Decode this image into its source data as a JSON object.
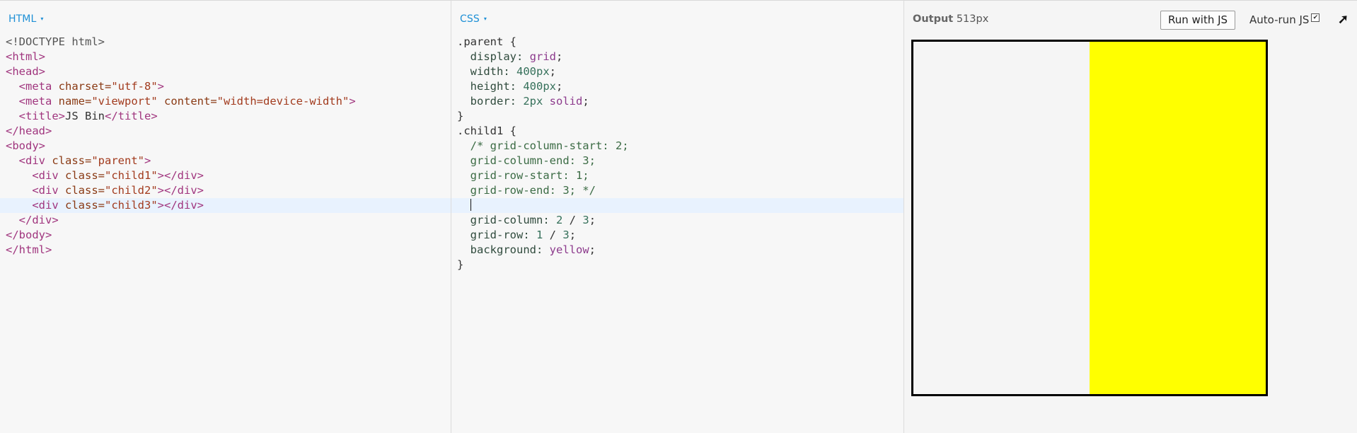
{
  "html_panel": {
    "label": "HTML",
    "caret": "▾",
    "lines": [
      [
        {
          "t": "<!DOCTYPE html>",
          "c": "doctype"
        }
      ],
      [
        {
          "t": "<html>",
          "c": "tag"
        }
      ],
      [
        {
          "t": "<head>",
          "c": "tag"
        }
      ],
      [
        {
          "t": "  "
        },
        {
          "t": "<meta ",
          "c": "tag"
        },
        {
          "t": "charset=",
          "c": "attr"
        },
        {
          "t": "\"utf-8\"",
          "c": "str"
        },
        {
          "t": ">",
          "c": "tag"
        }
      ],
      [
        {
          "t": "  "
        },
        {
          "t": "<meta ",
          "c": "tag"
        },
        {
          "t": "name=",
          "c": "attr"
        },
        {
          "t": "\"viewport\"",
          "c": "str"
        },
        {
          "t": " content=",
          "c": "attr"
        },
        {
          "t": "\"width=device-width\"",
          "c": "str"
        },
        {
          "t": ">",
          "c": "tag"
        }
      ],
      [
        {
          "t": "  "
        },
        {
          "t": "<title>",
          "c": "tag"
        },
        {
          "t": "JS Bin"
        },
        {
          "t": "</title>",
          "c": "tag"
        }
      ],
      [
        {
          "t": "</head>",
          "c": "tag"
        }
      ],
      [
        {
          "t": "<body>",
          "c": "tag"
        }
      ],
      [
        {
          "t": "  "
        },
        {
          "t": "<div ",
          "c": "tag"
        },
        {
          "t": "class=",
          "c": "attr"
        },
        {
          "t": "\"parent\"",
          "c": "str"
        },
        {
          "t": ">",
          "c": "tag"
        }
      ],
      [
        {
          "t": "    "
        },
        {
          "t": "<div ",
          "c": "tag"
        },
        {
          "t": "class=",
          "c": "attr"
        },
        {
          "t": "\"child1\"",
          "c": "str"
        },
        {
          "t": "></div>",
          "c": "tag"
        }
      ],
      [
        {
          "t": "    "
        },
        {
          "t": "<div ",
          "c": "tag"
        },
        {
          "t": "class=",
          "c": "attr"
        },
        {
          "t": "\"child2\"",
          "c": "str"
        },
        {
          "t": "></div>",
          "c": "tag"
        }
      ],
      [
        {
          "t": "    "
        },
        {
          "t": "<div ",
          "c": "tag"
        },
        {
          "t": "class=",
          "c": "attr"
        },
        {
          "t": "\"child3\"",
          "c": "str"
        },
        {
          "t": "></div>",
          "c": "tag"
        }
      ],
      [
        {
          "t": "  "
        },
        {
          "t": "</div>",
          "c": "tag"
        }
      ],
      [
        {
          "t": "</body>",
          "c": "tag"
        }
      ],
      [
        {
          "t": "</html>",
          "c": "tag"
        }
      ]
    ],
    "active_line": 11
  },
  "css_panel": {
    "label": "CSS",
    "caret": "▾",
    "lines": [
      [
        {
          "t": ".parent {",
          "c": "sel"
        }
      ],
      [
        {
          "t": "  "
        },
        {
          "t": "display: ",
          "c": "prop"
        },
        {
          "t": "grid",
          "c": "kw"
        },
        {
          "t": ";"
        }
      ],
      [
        {
          "t": "  "
        },
        {
          "t": "width: ",
          "c": "prop"
        },
        {
          "t": "400px",
          "c": "num"
        },
        {
          "t": ";"
        }
      ],
      [
        {
          "t": "  "
        },
        {
          "t": "height: ",
          "c": "prop"
        },
        {
          "t": "400px",
          "c": "num"
        },
        {
          "t": ";"
        }
      ],
      [
        {
          "t": "  "
        },
        {
          "t": "border: ",
          "c": "prop"
        },
        {
          "t": "2px",
          "c": "num"
        },
        {
          "t": " "
        },
        {
          "t": "solid",
          "c": "kw"
        },
        {
          "t": ";"
        }
      ],
      [
        {
          "t": "}",
          "c": "sel"
        }
      ],
      [
        {
          "t": ".child1 {",
          "c": "sel"
        }
      ],
      [
        {
          "t": "  "
        },
        {
          "t": "/* grid-column-start: 2;",
          "c": "comment"
        }
      ],
      [
        {
          "t": "  "
        },
        {
          "t": "grid-column-end: 3;",
          "c": "comment"
        }
      ],
      [
        {
          "t": "  "
        },
        {
          "t": "grid-row-start: 1;",
          "c": "comment"
        }
      ],
      [
        {
          "t": "  "
        },
        {
          "t": "grid-row-end: 3; */",
          "c": "comment"
        }
      ],
      [
        {
          "t": "  "
        },
        {
          "t": "",
          "cursor": true
        }
      ],
      [
        {
          "t": "  "
        },
        {
          "t": "grid-column: ",
          "c": "prop"
        },
        {
          "t": "2",
          "c": "num"
        },
        {
          "t": " / "
        },
        {
          "t": "3",
          "c": "num"
        },
        {
          "t": ";"
        }
      ],
      [
        {
          "t": "  "
        },
        {
          "t": "grid-row: ",
          "c": "prop"
        },
        {
          "t": "1",
          "c": "num"
        },
        {
          "t": " / "
        },
        {
          "t": "3",
          "c": "num"
        },
        {
          "t": ";"
        }
      ],
      [
        {
          "t": "  "
        },
        {
          "t": "background: ",
          "c": "prop"
        },
        {
          "t": "yellow",
          "c": "kw"
        },
        {
          "t": ";"
        }
      ],
      [
        {
          "t": "}",
          "c": "sel"
        }
      ]
    ],
    "active_line": 11
  },
  "output_panel": {
    "label_bold": "Output",
    "label_size": "513px",
    "run_button": "Run with JS",
    "autorun_label": "Auto-run JS",
    "autorun_checked": "✔",
    "popout_icon": "➚",
    "preview_colors": {
      "fill": "#ffff00",
      "border": "#000000"
    }
  }
}
